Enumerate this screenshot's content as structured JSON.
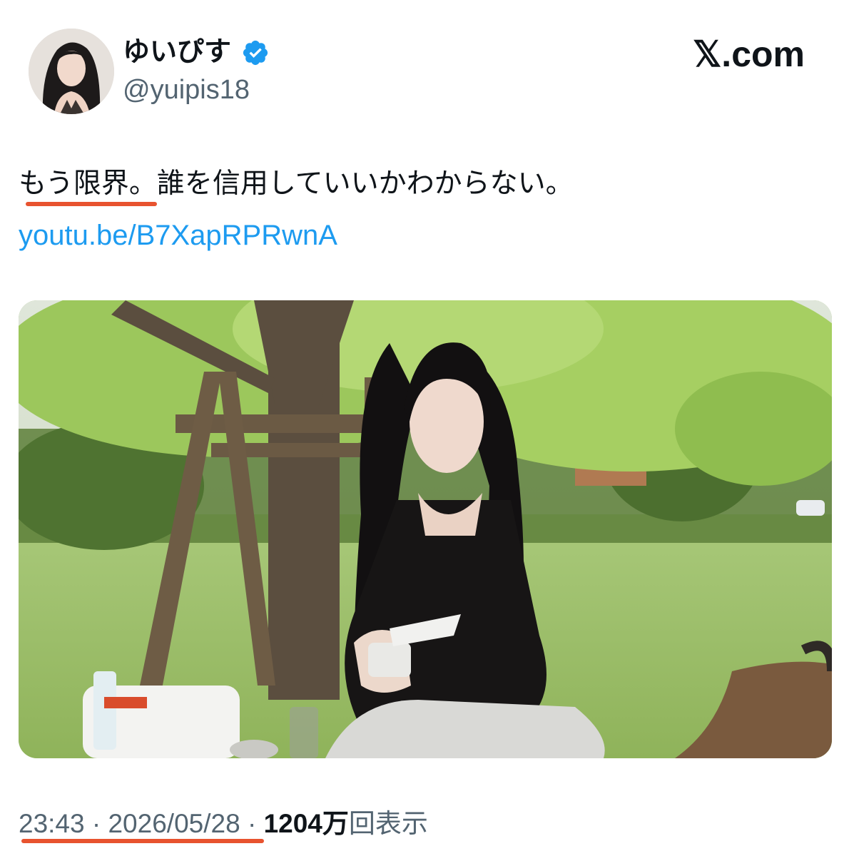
{
  "author": {
    "display_name": "ゆいぴす",
    "handle": "@yuipis18",
    "verified": true,
    "verified_color": "#1d9bf0"
  },
  "brand": {
    "label": "𝕏.com"
  },
  "tweet": {
    "text": "もう限界。誰を信用していいかわからない。",
    "link": "youtu.be/B7XapRPRwnA"
  },
  "meta": {
    "time": "23:43",
    "separator": " · ",
    "date": "2026/05/28",
    "views_number": "1204",
    "views_unit": "万",
    "views_label": "回表示"
  },
  "colors": {
    "annotation_underline": "#e8532f",
    "link": "#1d9bf0",
    "secondary_text": "#536471"
  }
}
